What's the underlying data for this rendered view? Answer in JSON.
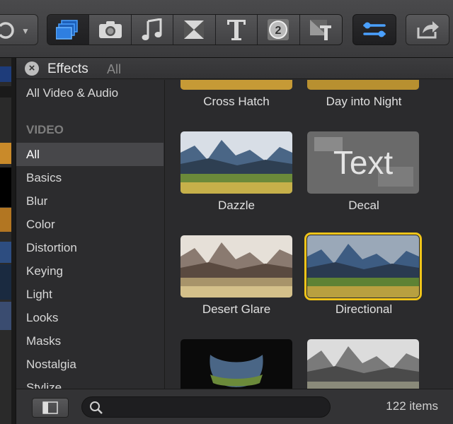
{
  "browser": {
    "title": "Effects",
    "crumb": "All",
    "close_label": "×"
  },
  "sidebar": {
    "all_item": "All Video & Audio",
    "section_video": "VIDEO",
    "items": [
      {
        "label": "All",
        "selected": true
      },
      {
        "label": "Basics"
      },
      {
        "label": "Blur"
      },
      {
        "label": "Color"
      },
      {
        "label": "Distortion"
      },
      {
        "label": "Keying"
      },
      {
        "label": "Light"
      },
      {
        "label": "Looks"
      },
      {
        "label": "Masks"
      },
      {
        "label": "Nostalgia"
      },
      {
        "label": "Stylize"
      }
    ]
  },
  "effects": [
    {
      "label": "Cross Hatch"
    },
    {
      "label": "Day into Night"
    },
    {
      "label": "Dazzle"
    },
    {
      "label": "Decal",
      "overlay_text": "Text"
    },
    {
      "label": "Desert Glare"
    },
    {
      "label": "Directional",
      "selected": true
    }
  ],
  "footer": {
    "search_value": "",
    "item_count": "122 items"
  },
  "colors": {
    "accent_blue": "#2f7fe0",
    "selection_yellow": "#f0c419"
  }
}
